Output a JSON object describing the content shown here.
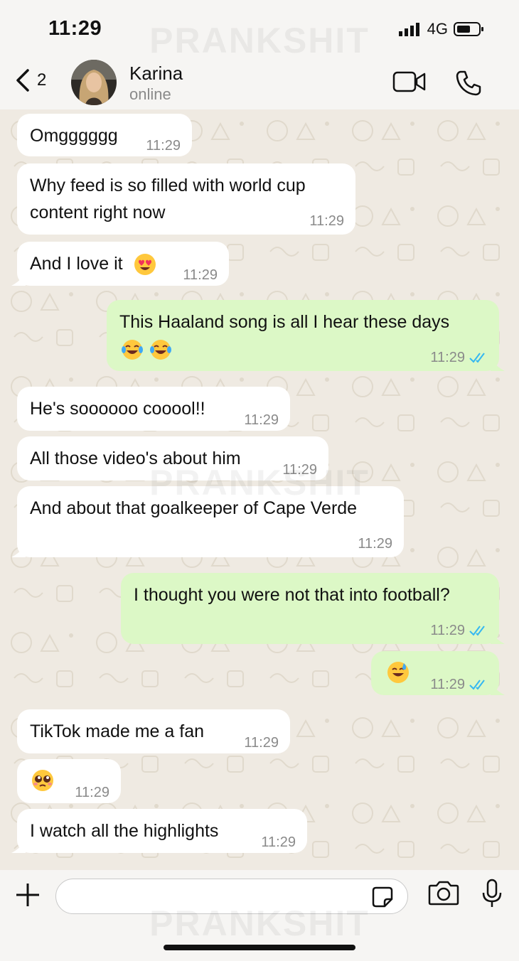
{
  "status_bar": {
    "time": "11:29",
    "network": "4G"
  },
  "watermark": "PRANKSHIT",
  "header": {
    "back_count": "2",
    "contact_name": "Karina",
    "contact_status": "online"
  },
  "messages": [
    {
      "direction": "in",
      "text": [
        "Omgggggg"
      ],
      "time": "11:29"
    },
    {
      "direction": "in",
      "text": [
        "Why feed is so filled with world cup",
        "content right now"
      ],
      "time": "11:29"
    },
    {
      "direction": "in",
      "text": [
        "And I love it"
      ],
      "emoji": "heart-eyes-emoji",
      "time": "11:29"
    },
    {
      "direction": "out",
      "text": [
        "This Haaland song is all I hear these days"
      ],
      "emoji": "tears-of-joy-emoji x2",
      "time": "11:29",
      "read": true
    },
    {
      "direction": "in",
      "text": [
        "He's soooooo cooool!!"
      ],
      "time": "11:29"
    },
    {
      "direction": "in",
      "text": [
        "All those video's about him"
      ],
      "time": "11:29"
    },
    {
      "direction": "in",
      "text": [
        "And about that goalkeeper of Cape Verde"
      ],
      "time": "11:29"
    },
    {
      "direction": "out",
      "text": [
        "I thought you were not that into football?"
      ],
      "time": "11:29",
      "read": true
    },
    {
      "direction": "out",
      "text": [],
      "emoji": "grinning-sweat-emoji",
      "time": "11:29",
      "read": true
    },
    {
      "direction": "in",
      "text": [
        "TikTok made me a fan"
      ],
      "time": "11:29"
    },
    {
      "direction": "in",
      "text": [],
      "emoji": "pleading-face-emoji",
      "time": "11:29"
    },
    {
      "direction": "in",
      "text": [
        "I watch all the highlights"
      ],
      "time": "11:29"
    }
  ],
  "composer": {
    "placeholder": ""
  },
  "colors": {
    "incoming_bubble": "#ffffff",
    "outgoing_bubble": "#dcf8c6",
    "read_ticks": "#34b7f1",
    "chat_bg": "#efeae2"
  }
}
